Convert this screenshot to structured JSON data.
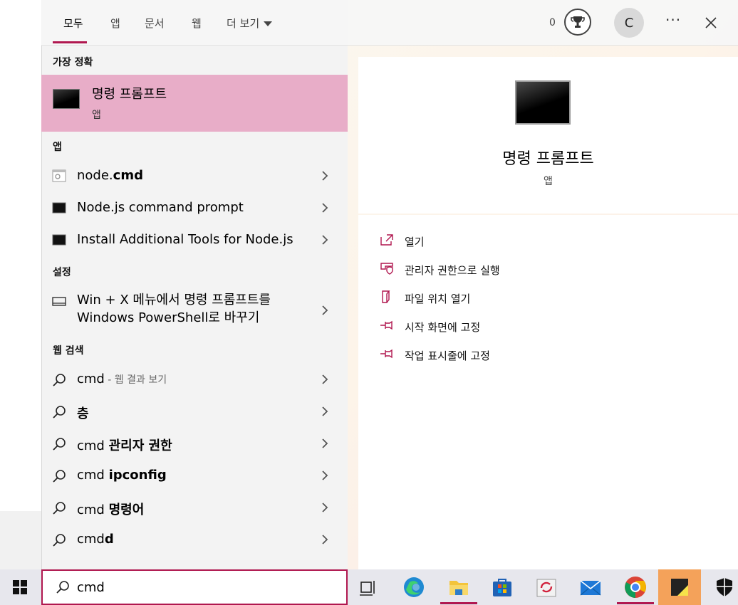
{
  "tabs": [
    {
      "label": "모두",
      "active": true
    },
    {
      "label": "앱"
    },
    {
      "label": "문서"
    },
    {
      "label": "웹"
    },
    {
      "label": "더 보기"
    }
  ],
  "header": {
    "points": "0",
    "avatar_initial": "C",
    "more_label": "···"
  },
  "sections": {
    "best": "가장 정확",
    "apps": "앱",
    "settings": "설정",
    "web": "웹 검색"
  },
  "best_match": {
    "title": "명령 프롬프트",
    "subtitle": "앱"
  },
  "apps": [
    {
      "name_pre": "node.",
      "name_bold": "cmd",
      "icon": "script-file-icon"
    },
    {
      "name": "Node.js command prompt",
      "icon": "console-icon"
    },
    {
      "name": "Install Additional Tools for Node.js",
      "icon": "console-icon"
    }
  ],
  "settings": [
    {
      "line1": "Win + X 메뉴에서 명령 프롬프트를",
      "line2": "Windows PowerShell로 바꾸기",
      "icon": "monitor-icon"
    }
  ],
  "web": [
    {
      "text": "cmd",
      "suffix": " - 웹 결과 보기"
    },
    {
      "bold": "층"
    },
    {
      "text": "cmd ",
      "bold": "관리자 권한"
    },
    {
      "text": "cmd ",
      "bold": "ipconfig"
    },
    {
      "text": "cmd ",
      "bold": "명령어"
    },
    {
      "text": "cmd",
      "bold": "d"
    }
  ],
  "detail": {
    "title": "명령 프롬프트",
    "subtitle": "앱",
    "actions": [
      {
        "label": "열기",
        "icon": "open-icon"
      },
      {
        "label": "관리자 권한으로 실행",
        "icon": "shield-icon"
      },
      {
        "label": "파일 위치 열기",
        "icon": "file-location-icon"
      },
      {
        "label": "시작 화면에 고정",
        "icon": "pin-icon"
      },
      {
        "label": "작업 표시줄에 고정",
        "icon": "pin-icon"
      }
    ]
  },
  "search": {
    "value": "cmd"
  },
  "taskbar": [
    "windows-logo-icon",
    "task-view-icon",
    "edge-icon",
    "file-explorer-icon",
    "microsoft-store-icon",
    "sync-app-icon",
    "mail-icon",
    "chrome-icon",
    "sticky-notes-icon",
    "security-icon"
  ],
  "colors": {
    "accent": "#b0174f",
    "highlight": "#e8adc8",
    "panel": "#f3f3f3"
  }
}
